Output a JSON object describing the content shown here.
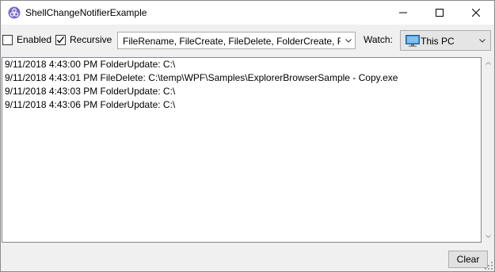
{
  "window": {
    "title": "ShellChangeNotifierExample",
    "app_icon": "shell-link-icon",
    "controls": {
      "minimize": "minimize-icon",
      "maximize": "maximize-icon",
      "close": "close-icon"
    }
  },
  "toolbar": {
    "enabled": {
      "label": "Enabled",
      "checked": false
    },
    "recursive": {
      "label": "Recursive",
      "checked": true
    },
    "events_value": "FileRename, FileCreate, FileDelete, FolderCreate, Folder",
    "watch_label": "Watch:",
    "watch_value": "This PC",
    "watch_icon": "computer-icon"
  },
  "log": [
    "9/11/2018 4:43:00 PM FolderUpdate: C:\\",
    "9/11/2018 4:43:01 PM FileDelete: C:\\temp\\WPF\\Samples\\ExplorerBrowserSample - Copy.exe",
    "9/11/2018 4:43:03 PM FolderUpdate: C:\\",
    "9/11/2018 4:43:06 PM FolderUpdate: C:\\"
  ],
  "footer": {
    "clear_label": "Clear"
  },
  "colors": {
    "titlebar": "#ffffff",
    "client": "#f0f0f0",
    "app_icon": "#7b68c8",
    "pc_screen": "#3a8fd9"
  }
}
